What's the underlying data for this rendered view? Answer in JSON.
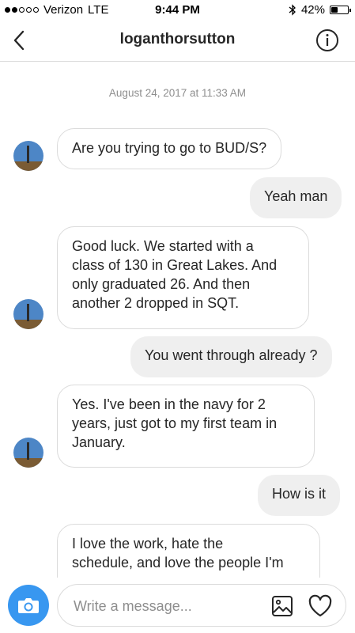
{
  "status_bar": {
    "carrier": "Verizon",
    "network": "LTE",
    "time": "9:44 PM",
    "battery": "42%",
    "battery_level": 0.42,
    "signal_bars": 2,
    "signal_total": 5
  },
  "header": {
    "title": "loganthorsutton",
    "back_icon": "chevron-left-icon",
    "info_icon": "info-icon"
  },
  "conversation": {
    "timestamp": "August 24, 2017 at 11:33 AM",
    "messages": [
      {
        "direction": "incoming",
        "lines": [
          "Are you trying to go to BUD/S?"
        ]
      },
      {
        "direction": "outgoing",
        "lines": [
          "Yeah man"
        ]
      },
      {
        "direction": "incoming",
        "lines": [
          "Good luck. We started with a",
          "class of 130 in Great Lakes. And",
          "only graduated 26. And then",
          "another 2 dropped in SQT."
        ]
      },
      {
        "direction": "outgoing",
        "lines": [
          "You went through already ?"
        ]
      },
      {
        "direction": "incoming",
        "lines": [
          "Yes. I've been in the navy for 2",
          "years, just got to my first team in",
          "January."
        ]
      },
      {
        "direction": "outgoing",
        "lines": [
          "How is it"
        ]
      },
      {
        "direction": "incoming",
        "lines": [
          "I love the work, hate the",
          "schedule, and love the people I'm"
        ]
      }
    ]
  },
  "composer": {
    "placeholder": "Write a message...",
    "camera_icon": "camera-icon",
    "gallery_icon": "gallery-icon",
    "heart_icon": "heart-icon"
  },
  "colors": {
    "accent": "#3897f0",
    "incoming_border": "#dbdbdb",
    "outgoing_bg": "#efefef",
    "timestamp": "#8e8e8e",
    "text": "#262626"
  }
}
